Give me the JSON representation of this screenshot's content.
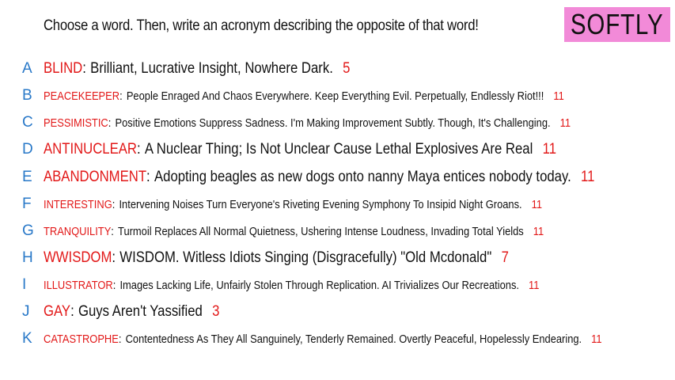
{
  "prompt": "Choose a word. Then, write an acronym describing the opposite of that word!",
  "badge": "SOFTLY",
  "colors": {
    "letter": "#2878c8",
    "word": "#e21818",
    "count": "#e21818",
    "badge_bg": "#f28ad8"
  },
  "rows": [
    {
      "letter": "A",
      "word": "BLIND",
      "acronym": "Brilliant, Lucrative Insight, Nowhere Dark.",
      "count": "5"
    },
    {
      "letter": "B",
      "word": "PEACEKEEPER",
      "acronym": "People Enraged And Chaos Everywhere. Keep Everything Evil. Perpetually, Endlessly Riot!!!",
      "count": "11"
    },
    {
      "letter": "C",
      "word": "PESSIMISTIC",
      "acronym": "Positive Emotions Suppress Sadness. I'm Making Improvement Subtly. Though, It's Challenging.",
      "count": "11"
    },
    {
      "letter": "D",
      "word": "ANTINUCLEAR",
      "acronym": "A Nuclear Thing; Is Not Unclear Cause Lethal Explosives Are Real",
      "count": "11"
    },
    {
      "letter": "E",
      "word": "ABANDONMENT",
      "acronym": "Adopting beagles as new dogs onto nanny Maya entices nobody today.",
      "count": "11"
    },
    {
      "letter": "F",
      "word": "INTERESTING",
      "acronym": "Intervening Noises Turn Everyone's Riveting Evening Symphony To Insipid Night Groans.",
      "count": "11"
    },
    {
      "letter": "G",
      "word": "TRANQUILITY",
      "acronym": "Turmoil Replaces All Normal Quietness, Ushering Intense Loudness, Invading Total Yields",
      "count": "11"
    },
    {
      "letter": "H",
      "word": "WWISDOM",
      "acronym": "WISDOM. Witless Idiots Singing (Disgracefully) \"Old Mcdonald\"",
      "count": "7"
    },
    {
      "letter": "I",
      "word": "ILLUSTRATOR",
      "acronym": "Images Lacking Life, Unfairly Stolen Through Replication. AI Trivializes Our Recreations.",
      "count": "11"
    },
    {
      "letter": "J",
      "word": "GAY",
      "acronym": "Guys Aren't Yassified",
      "count": "3"
    },
    {
      "letter": "K",
      "word": "CATASTROPHE",
      "acronym": "Contentedness As They All Sanguinely, Tenderly Remained. Overtly Peaceful, Hopelessly Endearing.",
      "count": "11"
    }
  ]
}
